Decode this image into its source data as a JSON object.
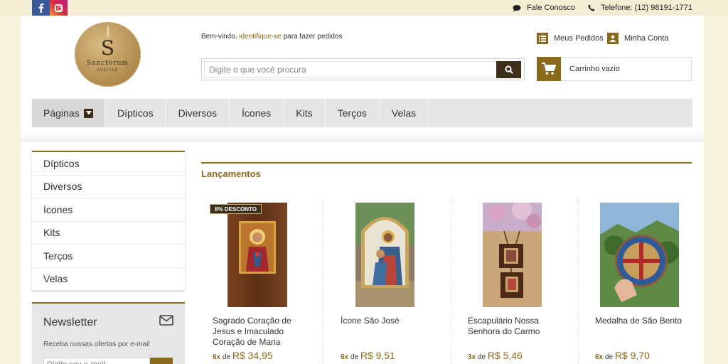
{
  "social": {
    "facebook_icon": "facebook-icon",
    "instagram_icon": "instagram-icon"
  },
  "toplinks": {
    "contact_label": "Fale Conosco",
    "phone_label": "Telefone: (12) 98191-1771"
  },
  "logo": {
    "monogram": "S",
    "name": "Sanctorum",
    "sub": "ATELIER"
  },
  "header": {
    "welcome_prefix": "Bem-vindo, ",
    "welcome_link": "identifique-se",
    "welcome_suffix": " para fazer pedidos",
    "orders_label": "Meus Pedidos",
    "account_label": "Minha Conta",
    "cart_label": "Carrinho vazio"
  },
  "search": {
    "placeholder": "Digite o que você procura"
  },
  "nav": {
    "pages_label": "Páginas",
    "items": [
      "Dípticos",
      "Diversos",
      "Ícones",
      "Kits",
      "Terços",
      "Velas"
    ]
  },
  "sidebar": {
    "items": [
      "Dípticos",
      "Diversos",
      "Ícones",
      "Kits",
      "Terços",
      "Velas"
    ]
  },
  "newsletter": {
    "title": "Newsletter",
    "description": "Receba nossas ofertas por e-mail",
    "placeholder": "Digite seu e-mail"
  },
  "section": {
    "title": "Lançamentos"
  },
  "products": [
    {
      "name": "Sagrado Coração de Jesus e Imaculado Coração de Maria",
      "installments": "6x",
      "de": "de",
      "price": "R$ 34,95",
      "badge": "8% DESCONTO"
    },
    {
      "name": "Ícone São José",
      "installments": "6x",
      "de": "de",
      "price": "R$ 9,51"
    },
    {
      "name": "Escapulário Nossa Senhora do Carmo",
      "installments": "3x",
      "de": "de",
      "price": "R$ 5,46"
    },
    {
      "name": "Medalha de São Bento",
      "installments": "6x",
      "de": "de",
      "price": "R$ 9,70"
    }
  ],
  "colors": {
    "accent": "#8a6a1d",
    "dark": "#3d2e1b",
    "page_bg": "#f6f1dc"
  }
}
